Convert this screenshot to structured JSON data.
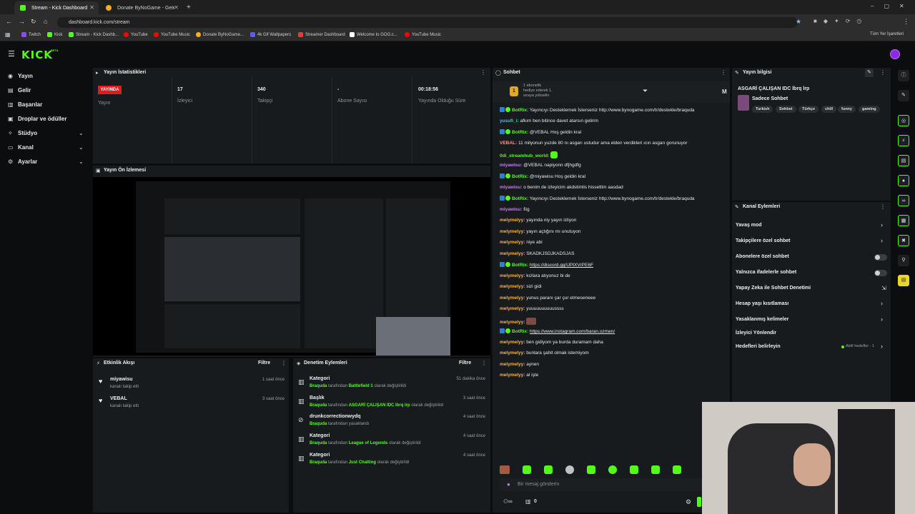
{
  "browser": {
    "tabs": [
      {
        "title": "Stream - Kick Dashboard",
        "active": true,
        "color": "#53fc18"
      },
      {
        "title": "Donate ByNoGame - Gelen/Gid",
        "active": false,
        "color": "#f2b01e"
      }
    ],
    "url": "dashboard.kick.com/stream",
    "bookmarks": [
      {
        "label": "Twitch",
        "color": "#9146ff"
      },
      {
        "label": "Kick",
        "color": "#53fc18"
      },
      {
        "label": "Stream - Kick Dashb...",
        "color": "#53fc18"
      },
      {
        "label": "YouTube",
        "color": "#ff0000"
      },
      {
        "label": "YouTube Music",
        "color": "#ff0000"
      },
      {
        "label": "Donate ByNoGame...",
        "color": "#f2b01e"
      },
      {
        "label": "4k Gif Wallpapers",
        "color": "#5a5aff"
      },
      {
        "label": "Streamer Dashboard",
        "color": "#ff3333"
      },
      {
        "label": "Welcome to GOG.c...",
        "color": "#ffffff"
      },
      {
        "label": "YouTube Music",
        "color": "#ff0000"
      }
    ],
    "all_bookmarks": "Tüm Yer İşaretleri"
  },
  "brand": {
    "logo": "KICK",
    "beta": "BETA",
    "accent": "#53fc18"
  },
  "sidebar": {
    "items": [
      {
        "label": "Yayın",
        "icon": "broadcast-icon"
      },
      {
        "label": "Gelir",
        "icon": "wallet-icon"
      },
      {
        "label": "Başarılar",
        "icon": "trophy-icon"
      },
      {
        "label": "Droplar ve ödüller",
        "icon": "gift-icon"
      },
      {
        "label": "Stüdyo",
        "icon": "studio-icon"
      },
      {
        "label": "Kanal",
        "icon": "channel-icon"
      },
      {
        "label": "Ayarlar",
        "icon": "gear-icon"
      }
    ]
  },
  "stats": {
    "title": "Yayın İstatistikleri",
    "live_badge": "YAYINDA",
    "items": [
      {
        "value": "",
        "label": "Yayın"
      },
      {
        "value": "17",
        "label": "İzleyici"
      },
      {
        "value": "340",
        "label": "Takipçi"
      },
      {
        "value": "-",
        "label": "Abone Sayısı"
      },
      {
        "value": "00:18:56",
        "label": "Yayında Olduğu Süre"
      }
    ]
  },
  "preview": {
    "title": "Yayın Ön İzlemesi"
  },
  "activity": {
    "title": "Etkinlik Akışı",
    "filter": "Filtre",
    "items": [
      {
        "name": "miyawisu",
        "sub": "kanalı takip etti",
        "time": "1 saat önce"
      },
      {
        "name": "VEBAL",
        "sub": "kanalı takip etti",
        "time": "3 saat önce"
      }
    ]
  },
  "moderation": {
    "title": "Denetim Eylemleri",
    "filter": "Filtre",
    "items": [
      {
        "name": "Kategori",
        "by": "Braquda",
        "mid": "tarafından",
        "target": "Battlefield 1",
        "end": "olarak değiştirildi",
        "time": "51 dakika önce"
      },
      {
        "name": "Başlık",
        "by": "Braquda",
        "mid": "tarafından",
        "target": "ASGARİ ÇALIŞAN IDC lbrq lrp",
        "end": "olarak değiştirildi",
        "time": "3 saat önce"
      },
      {
        "name": "drunkcorrectionwydq",
        "by": "Braquda",
        "mid": "tarafından yasaklandı",
        "target": "",
        "end": "",
        "time": "4 saat önce"
      },
      {
        "name": "Kategori",
        "by": "Braquda",
        "mid": "tarafından",
        "target": "League of Legends",
        "end": "olarak değiştirildi",
        "time": "4 saat önce"
      },
      {
        "name": "Kategori",
        "by": "Braquda",
        "mid": "tarafından",
        "target": "Just Chatting",
        "end": "olarak değiştirildi",
        "time": "4 saat önce"
      }
    ]
  },
  "chat": {
    "title": "Sohbet",
    "pinned_line1": "1 abonelik",
    "pinned_line2": "hediye ederek 1.",
    "pinned_line3": "sıraya yükselin",
    "messages": [
      {
        "user": "BotRix:",
        "cls": "bot",
        "badge": true,
        "text": "Yayıncıyı Desteklemek İsterseniz http://www.bynogame.com/tr/destekle/braquda"
      },
      {
        "user": "yusufi_i:",
        "cls": "yusufi",
        "text": "afkım ben bitince davet atarsın gelirim"
      },
      {
        "user": "BotRix:",
        "cls": "bot",
        "badge": true,
        "text": "@VEBAL Hoş geldin kral"
      },
      {
        "user": "VEBAL:",
        "cls": "vebal",
        "text": "11 milyonun yuzde 80 nı asgarı ustudur ama elden verdikleri ıcın asgarı gorunuyor"
      },
      {
        "user": "0di_streamhub_world:",
        "cls": "ddi",
        "text": "",
        "emote": true
      },
      {
        "user": "miyawisu:",
        "cls": "miya",
        "text": "@VEBAL napiyonn dfjhgdfg"
      },
      {
        "user": "BotRix:",
        "cls": "bot",
        "badge": true,
        "text": "@miyawisu Hoş geldin kral"
      },
      {
        "user": "miyawisu:",
        "cls": "miya",
        "text": "o benim de izleyicim akdstimlis hissettim aasdad"
      },
      {
        "user": "BotRix:",
        "cls": "bot",
        "badge": true,
        "text": "Yayıncıyı Desteklemek İsterseniz http://www.bynogame.com/tr/destekle/braquda"
      },
      {
        "user": "miyawisu:",
        "cls": "miya",
        "text": "fiig"
      },
      {
        "user": "melymelyy:",
        "cls": "mely",
        "text": "yayında niy yayın izliyon"
      },
      {
        "user": "melymelyy:",
        "cls": "mely",
        "text": "yayın açtığını mı unutuyon"
      },
      {
        "user": "melymelyy:",
        "cls": "mely",
        "text": "niye abi"
      },
      {
        "user": "melymelyy:",
        "cls": "mely",
        "text": "SKADKJSDJKADSJAS"
      },
      {
        "user": "BotRix:",
        "cls": "bot",
        "badge": true,
        "text": "https://discord.gg/UPtXVrPE6F",
        "link": true
      },
      {
        "user": "melymelyy:",
        "cls": "mely",
        "text": "kızlara atıyonuz bi de"
      },
      {
        "user": "melymelyy:",
        "cls": "mely",
        "text": "sizi gidi"
      },
      {
        "user": "melymelyy:",
        "cls": "mely",
        "text": "yunus paranı çar çur etmeseneee"
      },
      {
        "user": "melymelyy:",
        "cls": "mely",
        "text": "yuuuuuuuuuussss"
      },
      {
        "user": "melymelyy:",
        "cls": "mely",
        "text": "",
        "emote2": true
      },
      {
        "user": "BotRix:",
        "cls": "bot",
        "badge": true,
        "text": "https://www.instagram.com/baran.ozmen/",
        "link": true
      },
      {
        "user": "melymelyy:",
        "cls": "mely",
        "text": "ben gidiyom ya burda duramam daha"
      },
      {
        "user": "melymelyy:",
        "cls": "mely",
        "text": "bunlara şahit olmak istemiyom"
      },
      {
        "user": "melymelyy:",
        "cls": "mely",
        "text": "aynen"
      },
      {
        "user": "melymelyy:",
        "cls": "mely",
        "text": "al işte"
      }
    ],
    "input_placeholder": "Bir mesaj gönderin",
    "viewer_count": "0",
    "letter": "M"
  },
  "stream_info": {
    "title": "Yayın bilgisi",
    "stream_title": "ASGARİ ÇALIŞAN IDC lbrq lrp",
    "category": "Sadece Sohbet",
    "tags": [
      "Turkish",
      "Sohbet",
      "Türkçe",
      "chill",
      "funny",
      "gaming"
    ]
  },
  "channel_actions": {
    "title": "Kanal Eylemleri",
    "items": [
      {
        "label": "Yavaş mod",
        "control": "chevron"
      },
      {
        "label": "Takipçilere özel sohbet",
        "control": "chevron"
      },
      {
        "label": "Abonelere özel sohbet",
        "control": "toggle"
      },
      {
        "label": "Yalnızca ifadelerle sohbet",
        "control": "toggle"
      },
      {
        "label": "Yapay Zeka ile Sohbet Denetimi",
        "control": "external"
      },
      {
        "label": "Hesap yaşı kısıtlaması",
        "control": "chevron"
      },
      {
        "label": "Yasaklanmış kelimeler",
        "control": "chevron"
      },
      {
        "label": "İzleyici Yönlendir",
        "control": "none"
      },
      {
        "label": "Hedefleri belirleyin",
        "control": "chevron"
      }
    ],
    "goal_status": "Aktif hedefler - 1"
  }
}
